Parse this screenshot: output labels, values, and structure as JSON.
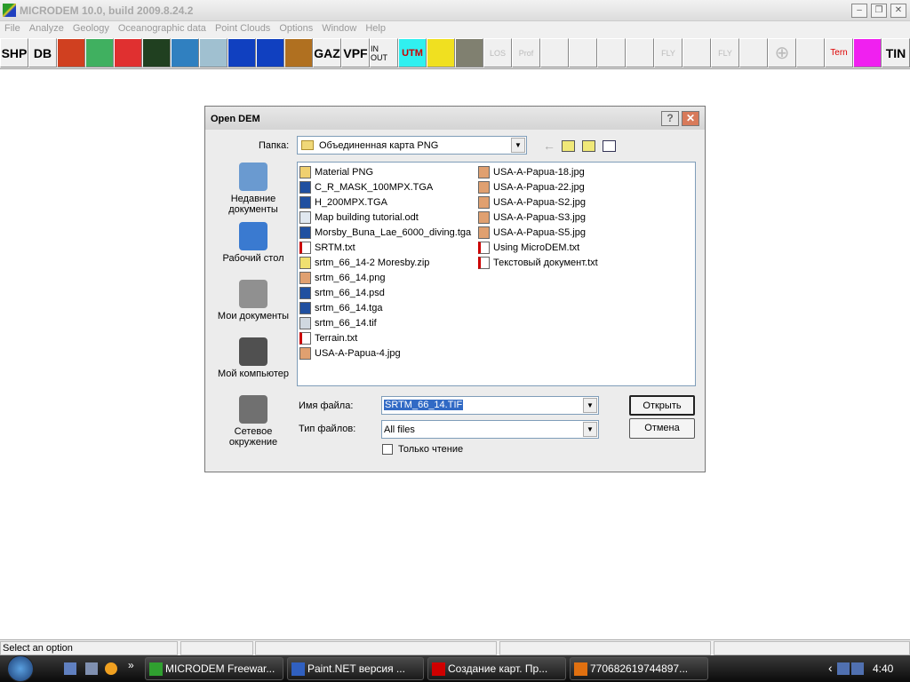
{
  "window": {
    "title": "MICRODEM 10.0, build 2009.8.24.2",
    "minimize": "–",
    "restore": "❐",
    "close": "✕"
  },
  "menu": [
    "File",
    "Analyze",
    "Geology",
    "Oceanographic data",
    "Point Clouds",
    "Options",
    "Window",
    "Help"
  ],
  "toolbar": [
    {
      "label": "SHP",
      "icon": "shp-button"
    },
    {
      "label": "DB",
      "icon": "db-button"
    },
    {
      "label": "",
      "icon": "map-overlay-icon",
      "color": "#d04020"
    },
    {
      "label": "",
      "icon": "dem-map-icon",
      "color": "#40b060"
    },
    {
      "label": "",
      "icon": "satellite-red-icon",
      "color": "#e03030"
    },
    {
      "label": "",
      "icon": "satellite-image-icon",
      "color": "#204020"
    },
    {
      "label": "",
      "icon": "3d-block-icon",
      "color": "#3080c0"
    },
    {
      "label": "",
      "icon": "nautical-chart-icon",
      "color": "#a0c0d0"
    },
    {
      "label": "",
      "icon": "globe-icon",
      "color": "#1040c0"
    },
    {
      "label": "",
      "icon": "globe-target-icon",
      "color": "#1040c0"
    },
    {
      "label": "",
      "icon": "tiger-icon",
      "color": "#b07020"
    },
    {
      "label": "GAZ",
      "icon": "gaz-button"
    },
    {
      "label": "VPF",
      "icon": "vpf-button"
    },
    {
      "label": "IN OUT",
      "icon": "in-out-button"
    },
    {
      "label": "UTM",
      "icon": "utm-button",
      "color": "#30f0f0"
    },
    {
      "label": "",
      "icon": "sun-icon",
      "color": "#f0e020"
    },
    {
      "label": "",
      "icon": "moon-icon",
      "color": "#808070"
    },
    {
      "label": "LOS",
      "icon": "los-button"
    },
    {
      "label": "Prof",
      "icon": "profile-button"
    },
    {
      "label": "",
      "icon": "mesh-icon"
    },
    {
      "label": "",
      "icon": "mesh-icon-2"
    },
    {
      "label": "",
      "icon": "mesh-icon-3"
    },
    {
      "label": "",
      "icon": "building-icon"
    },
    {
      "label": "FLY",
      "icon": "fly-button"
    },
    {
      "label": "",
      "icon": "target-rings-icon"
    },
    {
      "label": "FLY",
      "icon": "fly-button-2"
    },
    {
      "label": "",
      "icon": "cloud-icon"
    },
    {
      "label": "⊕",
      "icon": "crosshair-icon"
    },
    {
      "label": "",
      "icon": "wire-globe-icon"
    },
    {
      "label": "Tern",
      "icon": "ternary-button"
    },
    {
      "label": "",
      "icon": "stratigraphy-icon",
      "color": "#f020f0"
    },
    {
      "label": "TIN",
      "icon": "tin-button"
    }
  ],
  "dialog": {
    "title": "Open DEM",
    "help": "?",
    "close": "✕",
    "folder_label": "Папка:",
    "folder": "Объединенная карта PNG",
    "places": [
      "Недавние документы",
      "Рабочий стол",
      "Мои документы",
      "Мой компьютер",
      "Сетевое окружение"
    ],
    "files_col1": [
      {
        "name": "Material PNG",
        "type": "folder"
      },
      {
        "name": "C_R_MASK_100MPX.TGA",
        "type": "ps"
      },
      {
        "name": "H_200MPX.TGA",
        "type": "ps"
      },
      {
        "name": "Map building tutorial.odt",
        "type": "doc"
      },
      {
        "name": "Morsby_Buna_Lae_6000_diving.tga",
        "type": "ps"
      },
      {
        "name": "SRTM.txt",
        "type": "txt"
      },
      {
        "name": "srtm_66_14-2 Moresby.zip",
        "type": "zip"
      },
      {
        "name": "srtm_66_14.png",
        "type": "img"
      },
      {
        "name": "srtm_66_14.psd",
        "type": "ps"
      },
      {
        "name": "srtm_66_14.tga",
        "type": "ps"
      },
      {
        "name": "srtm_66_14.tif",
        "type": "tif"
      },
      {
        "name": "Terrain.txt",
        "type": "txt"
      },
      {
        "name": "USA-A-Papua-4.jpg",
        "type": "img"
      }
    ],
    "files_col2": [
      {
        "name": "USA-A-Papua-18.jpg",
        "type": "img"
      },
      {
        "name": "USA-A-Papua-22.jpg",
        "type": "img"
      },
      {
        "name": "USA-A-Papua-S2.jpg",
        "type": "img"
      },
      {
        "name": "USA-A-Papua-S3.jpg",
        "type": "img"
      },
      {
        "name": "USA-A-Papua-S5.jpg",
        "type": "img"
      },
      {
        "name": "Using MicroDEM.txt",
        "type": "txt"
      },
      {
        "name": "Текстовый документ.txt",
        "type": "txt"
      }
    ],
    "filename_label": "Имя файла:",
    "filename": "SRTM_66_14.TIF",
    "filetype_label": "Тип файлов:",
    "filetype": "All files",
    "readonly_label": "Только чтение",
    "readonly": false,
    "open": "Открыть",
    "cancel": "Отмена"
  },
  "status": {
    "text": "Select an option"
  },
  "taskbar": {
    "tasks": [
      "MICRODEM Freewar...",
      "Paint.NET версия ...",
      "Создание карт. Пр...",
      "770682619744897..."
    ],
    "clock": "4:40",
    "tray_arrow": "‹",
    "quicklaunch_more": "»"
  }
}
